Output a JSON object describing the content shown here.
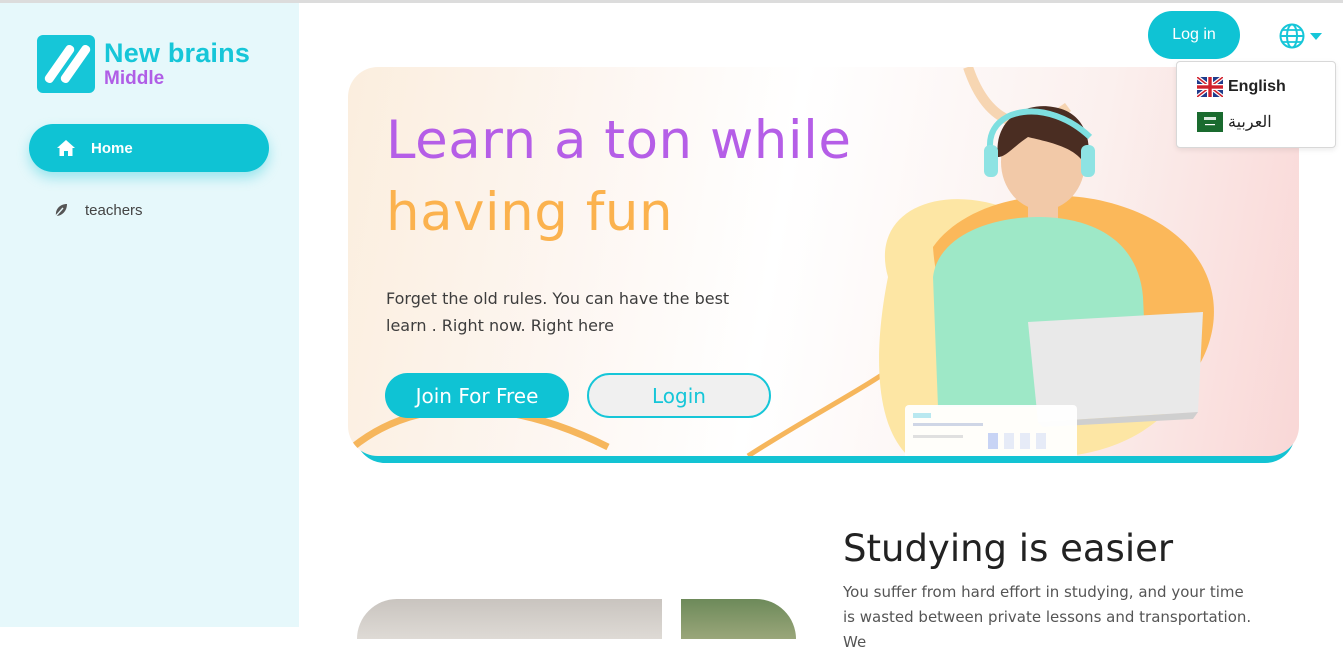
{
  "brand": {
    "name": "New brains",
    "sub": "Middle",
    "colors": {
      "primary": "#16c6d8",
      "purple": "#b05ee6",
      "orange": "#fbb24e"
    }
  },
  "sidebar": {
    "items": [
      {
        "label": "Home",
        "icon": "home-icon",
        "active": true
      },
      {
        "label": "teachers",
        "icon": "leaf-icon",
        "active": false
      }
    ]
  },
  "header": {
    "login_label": "Log in",
    "language_icon": "globe-icon",
    "languages": [
      {
        "label": "English",
        "flag": "uk-flag-icon"
      },
      {
        "label": "العربية",
        "flag": "saudi-flag-icon"
      }
    ]
  },
  "hero": {
    "title_line1": "Learn a ton while",
    "title_line2": "having fun",
    "text": "Forget the old rules. You can have the best learn . Right now. Right here",
    "join_label": "Join For Free",
    "login_label": "Login"
  },
  "study": {
    "title": "Studying is easier",
    "text": "You suffer from hard effort in studying, and your time is wasted between private lessons and transportation. We"
  }
}
